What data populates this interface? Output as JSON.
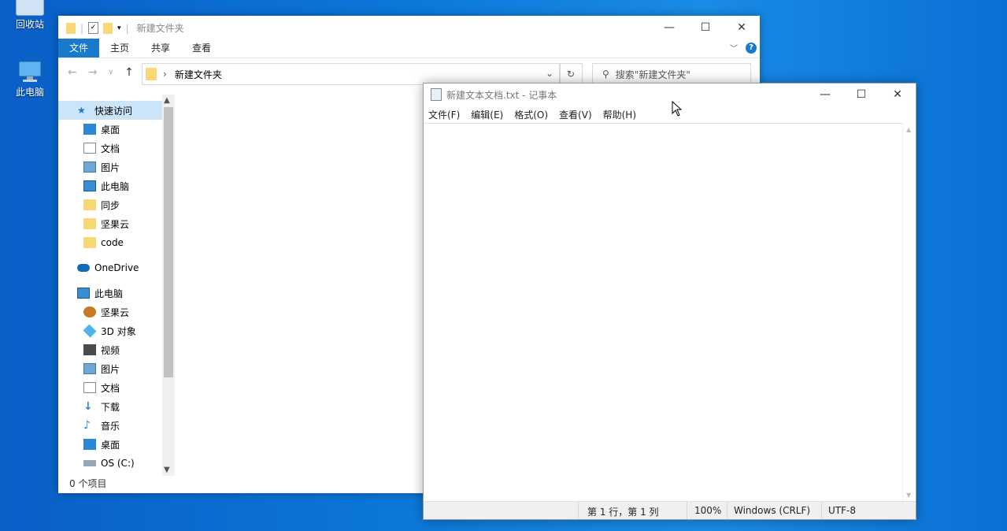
{
  "desktop": {
    "icons": [
      {
        "label": "回收站",
        "icon": "recycle-bin-icon"
      },
      {
        "label": "此电脑",
        "icon": "computer-icon"
      }
    ]
  },
  "explorer": {
    "title": "新建文件夹",
    "ribbon_tabs": [
      "文件",
      "主页",
      "共享",
      "查看"
    ],
    "help_glyph": "?",
    "address_path": "新建文件夹",
    "search_placeholder": "搜索\"新建文件夹\"",
    "nav": {
      "quick_access": "快速访问",
      "quick_items": [
        "桌面",
        "文档",
        "图片",
        "此电脑",
        "同步",
        "坚果云",
        "code"
      ],
      "onedrive": "OneDrive",
      "this_pc": "此电脑",
      "pc_items": [
        "坚果云",
        "3D 对象",
        "视频",
        "图片",
        "文档",
        "下载",
        "音乐",
        "桌面",
        "OS (C:)"
      ]
    },
    "status": "0 个项目",
    "accent": "#1979ca"
  },
  "notepad": {
    "title": "新建文本文档.txt - 记事本",
    "menu": [
      "文件(F)",
      "编辑(E)",
      "格式(O)",
      "查看(V)",
      "帮助(H)"
    ],
    "content": "",
    "status": {
      "position": "第 1 行，第 1 列",
      "zoom": "100%",
      "line_ending": "Windows (CRLF)",
      "encoding": "UTF-8"
    }
  }
}
